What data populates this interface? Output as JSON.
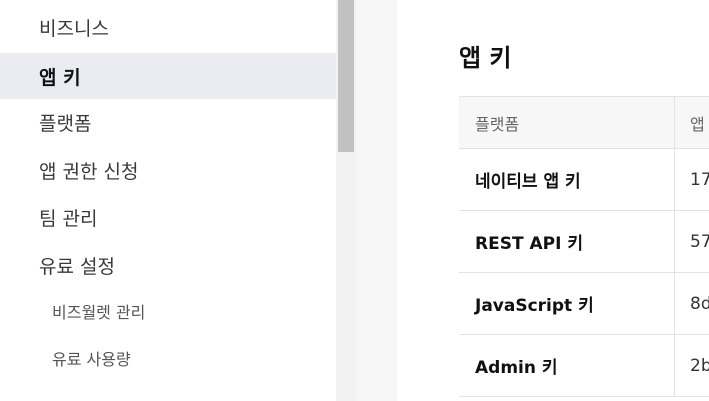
{
  "sidebar": {
    "items": [
      {
        "label": "비즈니스"
      },
      {
        "label": "앱 키"
      },
      {
        "label": "플랫폼"
      },
      {
        "label": "앱 권한 신청"
      },
      {
        "label": "팀 관리"
      },
      {
        "label": "유료 설정"
      }
    ],
    "sub_items": [
      {
        "label": "비즈월렛 관리"
      },
      {
        "label": "유료 사용량"
      }
    ],
    "active_index": 1
  },
  "main": {
    "title": "앱 키",
    "table": {
      "headers": [
        "플랫폼",
        "앱"
      ],
      "rows": [
        {
          "platform": "네이티브 앱 키",
          "key": "17"
        },
        {
          "platform": "REST API 키",
          "key": "57"
        },
        {
          "platform": "JavaScript 키",
          "key": "8d"
        },
        {
          "platform": "Admin 키",
          "key": "2b"
        }
      ]
    }
  },
  "colors": {
    "active_bg": "#ebebf2",
    "scrollbar_thumb": "#c1c1c1",
    "table_header_bg": "#f7f7f7"
  }
}
